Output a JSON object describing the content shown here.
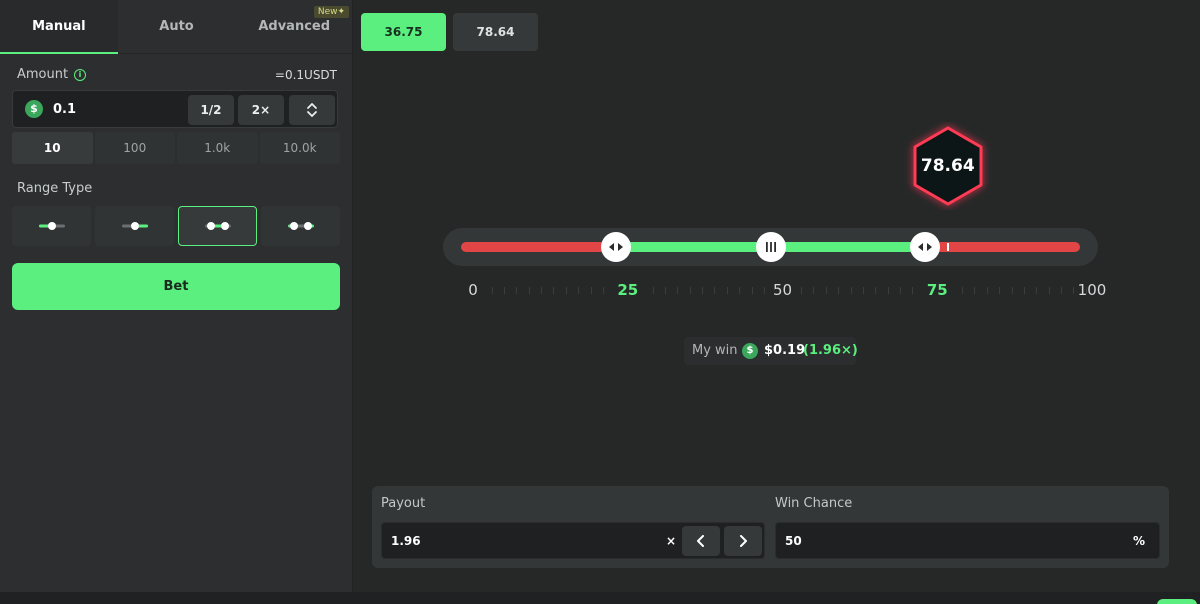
{
  "tabs": [
    {
      "label": "Manual",
      "active": true
    },
    {
      "label": "Auto",
      "active": false
    },
    {
      "label": "Advanced",
      "active": false,
      "badge": "New✦"
    }
  ],
  "amount": {
    "label": "Amount",
    "conversion": "=0.1USDT",
    "value": "0.1",
    "currency_icon": "$",
    "half_label": "1/2",
    "double_label": "2×"
  },
  "quick_amounts": [
    "10",
    "100",
    "1.0k",
    "10.0k"
  ],
  "range_type": {
    "label": "Range Type",
    "options": [
      "range-under-icon",
      "range-over-icon",
      "range-inside-icon",
      "range-outside-icon"
    ],
    "selected_index": 2
  },
  "bet_label": "Bet",
  "history": [
    "36.75",
    "78.64"
  ],
  "result": {
    "value": "78.64",
    "fraction": 0.7864
  },
  "slider": {
    "min": 0,
    "max": 100,
    "low": 25,
    "high": 75,
    "scale_labels": [
      "0",
      "25",
      "50",
      "75",
      "100"
    ]
  },
  "my_win": {
    "label": "My win",
    "icon": "$",
    "amount": "$0.19",
    "multiplier": "(1.96×)"
  },
  "payout": {
    "label": "Payout",
    "value": "1.96",
    "unit": "×"
  },
  "win_chance": {
    "label": "Win Chance",
    "value": "50",
    "unit": "%"
  },
  "colors": {
    "accent": "#5aef7f",
    "loss": "#e24545",
    "background": "#262828"
  }
}
